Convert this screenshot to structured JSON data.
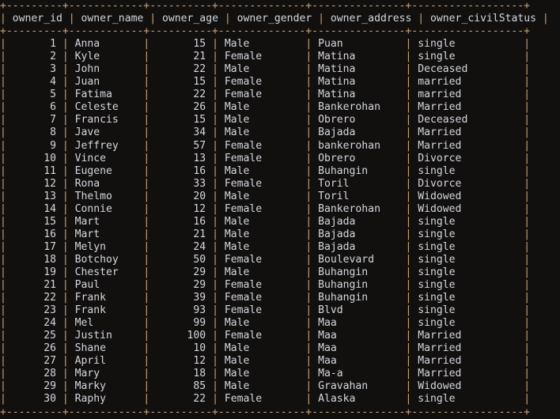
{
  "terminal": {
    "background_color": "#12100f",
    "text_color": "#d3d7de",
    "border_color": "#c9a37a"
  },
  "table": {
    "name": "owner",
    "columns": [
      {
        "key": "owner_id",
        "label": "owner_id",
        "width": 9,
        "align": "right"
      },
      {
        "key": "owner_name",
        "label": "owner_name",
        "width": 12,
        "align": "left"
      },
      {
        "key": "owner_age",
        "label": "owner_age",
        "width": 10,
        "align": "right"
      },
      {
        "key": "owner_gender",
        "label": "owner_gender",
        "width": 14,
        "align": "left"
      },
      {
        "key": "owner_address",
        "label": "owner_address",
        "width": 15,
        "align": "left"
      },
      {
        "key": "owner_civilStatus",
        "label": "owner_civilStatus",
        "width": 18,
        "align": "left"
      }
    ],
    "rows": [
      {
        "owner_id": "1",
        "owner_name": "Anna",
        "owner_age": "15",
        "owner_gender": "Male",
        "owner_address": "Puan",
        "owner_civilStatus": "single"
      },
      {
        "owner_id": "2",
        "owner_name": "Kyle",
        "owner_age": "21",
        "owner_gender": "Female",
        "owner_address": "Matina",
        "owner_civilStatus": "single"
      },
      {
        "owner_id": "3",
        "owner_name": "John",
        "owner_age": "22",
        "owner_gender": "Male",
        "owner_address": "Matina",
        "owner_civilStatus": "Deceased"
      },
      {
        "owner_id": "4",
        "owner_name": "Juan",
        "owner_age": "15",
        "owner_gender": "Female",
        "owner_address": "Matina",
        "owner_civilStatus": "married"
      },
      {
        "owner_id": "5",
        "owner_name": "Fatima",
        "owner_age": "22",
        "owner_gender": "Female",
        "owner_address": "Matina",
        "owner_civilStatus": "married"
      },
      {
        "owner_id": "6",
        "owner_name": "Celeste",
        "owner_age": "26",
        "owner_gender": "Male",
        "owner_address": "Bankerohan",
        "owner_civilStatus": "Married"
      },
      {
        "owner_id": "7",
        "owner_name": "Francis",
        "owner_age": "15",
        "owner_gender": "Male",
        "owner_address": "Obrero",
        "owner_civilStatus": "Deceased"
      },
      {
        "owner_id": "8",
        "owner_name": "Jave",
        "owner_age": "34",
        "owner_gender": "Male",
        "owner_address": "Bajada",
        "owner_civilStatus": "Married"
      },
      {
        "owner_id": "9",
        "owner_name": "Jeffrey",
        "owner_age": "57",
        "owner_gender": "Female",
        "owner_address": "bankerohan",
        "owner_civilStatus": "Married"
      },
      {
        "owner_id": "10",
        "owner_name": "Vince",
        "owner_age": "13",
        "owner_gender": "Female",
        "owner_address": "Obrero",
        "owner_civilStatus": "Divorce"
      },
      {
        "owner_id": "11",
        "owner_name": "Eugene",
        "owner_age": "16",
        "owner_gender": "Male",
        "owner_address": "Buhangin",
        "owner_civilStatus": "single"
      },
      {
        "owner_id": "12",
        "owner_name": "Rona",
        "owner_age": "33",
        "owner_gender": "Female",
        "owner_address": "Toril",
        "owner_civilStatus": "Divorce"
      },
      {
        "owner_id": "13",
        "owner_name": "Thelmo",
        "owner_age": "20",
        "owner_gender": "Male",
        "owner_address": "Toril",
        "owner_civilStatus": "Widowed"
      },
      {
        "owner_id": "14",
        "owner_name": "Connie",
        "owner_age": "12",
        "owner_gender": "Female",
        "owner_address": "Bankerohan",
        "owner_civilStatus": "Widowed"
      },
      {
        "owner_id": "15",
        "owner_name": "Mart",
        "owner_age": "16",
        "owner_gender": "Male",
        "owner_address": "Bajada",
        "owner_civilStatus": "single"
      },
      {
        "owner_id": "16",
        "owner_name": "Mart",
        "owner_age": "21",
        "owner_gender": "Male",
        "owner_address": "Bajada",
        "owner_civilStatus": "single"
      },
      {
        "owner_id": "17",
        "owner_name": "Melyn",
        "owner_age": "24",
        "owner_gender": "Male",
        "owner_address": "Bajada",
        "owner_civilStatus": "single"
      },
      {
        "owner_id": "18",
        "owner_name": "Botchoy",
        "owner_age": "50",
        "owner_gender": "Female",
        "owner_address": "Boulevard",
        "owner_civilStatus": "single"
      },
      {
        "owner_id": "19",
        "owner_name": "Chester",
        "owner_age": "29",
        "owner_gender": "Male",
        "owner_address": "Buhangin",
        "owner_civilStatus": "single"
      },
      {
        "owner_id": "21",
        "owner_name": "Paul",
        "owner_age": "29",
        "owner_gender": "Female",
        "owner_address": "Buhangin",
        "owner_civilStatus": "single"
      },
      {
        "owner_id": "22",
        "owner_name": "Frank",
        "owner_age": "39",
        "owner_gender": "Female",
        "owner_address": "Buhangin",
        "owner_civilStatus": "single"
      },
      {
        "owner_id": "23",
        "owner_name": "Frank",
        "owner_age": "93",
        "owner_gender": "Female",
        "owner_address": "Blvd",
        "owner_civilStatus": "single"
      },
      {
        "owner_id": "24",
        "owner_name": "Mel",
        "owner_age": "99",
        "owner_gender": "Male",
        "owner_address": "Maa",
        "owner_civilStatus": "single"
      },
      {
        "owner_id": "25",
        "owner_name": "Justin",
        "owner_age": "100",
        "owner_gender": "Female",
        "owner_address": "Maa",
        "owner_civilStatus": "Married"
      },
      {
        "owner_id": "26",
        "owner_name": "Shane",
        "owner_age": "10",
        "owner_gender": "Male",
        "owner_address": "Maa",
        "owner_civilStatus": "Married"
      },
      {
        "owner_id": "27",
        "owner_name": "April",
        "owner_age": "12",
        "owner_gender": "Male",
        "owner_address": "Maa",
        "owner_civilStatus": "Married"
      },
      {
        "owner_id": "28",
        "owner_name": "Mary",
        "owner_age": "18",
        "owner_gender": "Male",
        "owner_address": "Ma-a",
        "owner_civilStatus": "Married"
      },
      {
        "owner_id": "29",
        "owner_name": "Marky",
        "owner_age": "85",
        "owner_gender": "Male",
        "owner_address": "Gravahan",
        "owner_civilStatus": "Widowed"
      },
      {
        "owner_id": "30",
        "owner_name": "Raphy",
        "owner_age": "22",
        "owner_gender": "Female",
        "owner_address": "Alaska",
        "owner_civilStatus": "single"
      }
    ]
  }
}
